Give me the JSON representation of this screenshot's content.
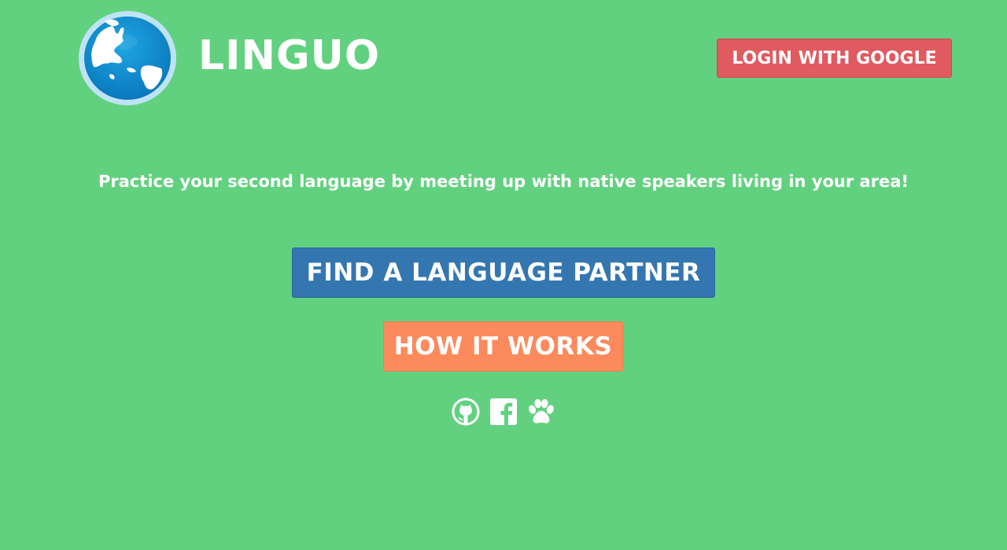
{
  "header": {
    "brand_name": "LINGUO",
    "logo_icon": "globe-icon",
    "login_label": "LOGIN WITH GOOGLE"
  },
  "hero": {
    "tagline": "Practice your second language by meeting up with native speakers living in your area!",
    "primary_cta_label": "FIND A LANGUAGE PARTNER",
    "secondary_cta_label": "HOW IT WORKS"
  },
  "social_links": [
    {
      "icon": "github-icon"
    },
    {
      "icon": "facebook-icon"
    },
    {
      "icon": "paw-icon"
    }
  ],
  "colors": {
    "background": "#62d17f",
    "login_button": "#e05a5f",
    "primary_cta": "#3477b0",
    "secondary_cta": "#fb8a5c",
    "text": "#ffffff"
  }
}
